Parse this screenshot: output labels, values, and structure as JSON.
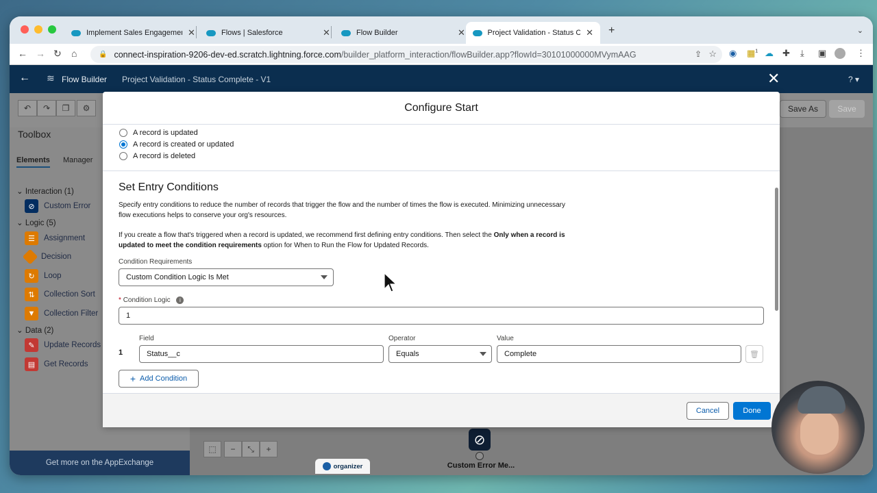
{
  "browser": {
    "tabs": [
      {
        "label": "Implement Sales Engagement"
      },
      {
        "label": "Flows | Salesforce"
      },
      {
        "label": "Flow Builder"
      },
      {
        "label": "Project Validation - Status Co"
      }
    ],
    "url_host": "connect-inspiration-9206-dev-ed.scratch.lightning.force.com",
    "url_path": "/builder_platform_interaction/flowBuilder.app?flowId=30101000000MVymAAG",
    "ext_badge": "1"
  },
  "app": {
    "title": "Flow Builder",
    "flow_name": "Project Validation - Status Complete - V1",
    "help": "?",
    "save_as": "Save As",
    "save": "Save"
  },
  "toolbox": {
    "title": "Toolbox",
    "tab_elements": "Elements",
    "tab_manager": "Manager",
    "sections": [
      {
        "label": "Interaction (1)",
        "items": [
          {
            "label": "Custom Error",
            "color": "#032d60"
          }
        ]
      },
      {
        "label": "Logic (5)",
        "items": [
          {
            "label": "Assignment",
            "color": "#dd7a01"
          },
          {
            "label": "Decision",
            "color": "#dd7a01"
          },
          {
            "label": "Loop",
            "color": "#dd7a01"
          },
          {
            "label": "Collection Sort",
            "color": "#dd7a01"
          },
          {
            "label": "Collection Filter",
            "color": "#dd7a01"
          }
        ]
      },
      {
        "label": "Data (2)",
        "items": [
          {
            "label": "Update Records",
            "color": "#c23934"
          },
          {
            "label": "Get Records",
            "color": "#c23934"
          }
        ]
      }
    ],
    "appexchange": "Get more on the AppExchange"
  },
  "canvas": {
    "node_label": "Custom Error Me...",
    "organizer_label": "organizer"
  },
  "modal": {
    "title": "Configure Start",
    "radios": [
      {
        "label": "A record is updated",
        "selected": false
      },
      {
        "label": "A record is created or updated",
        "selected": true
      },
      {
        "label": "A record is deleted",
        "selected": false
      }
    ],
    "section_title": "Set Entry Conditions",
    "para1_line1": "Specify entry conditions to reduce the number of records that trigger the flow and the number of times the flow is executed. Minimizing unnecessary",
    "para1_line2": "flow executions helps to conserve your org's resources.",
    "para2_a": "If you create a flow that's triggered when a record is updated, we recommend first defining entry conditions. Then select the ",
    "para2_bold1": "Only when a record is",
    "para2_bold2": "updated to meet the condition requirements",
    "para2_b": " option for When to Run the Flow for Updated Records.",
    "condition_requirements_label": "Condition Requirements",
    "condition_requirements_value": "Custom Condition Logic Is Met",
    "condition_logic_label": "Condition Logic",
    "condition_logic_value": "1",
    "field_header": "Field",
    "operator_header": "Operator",
    "value_header": "Value",
    "row_number": "1",
    "field_value": "Status__c",
    "operator_value": "Equals",
    "value_value": "Complete",
    "add_condition": "Add Condition",
    "cancel": "Cancel",
    "done": "Done"
  }
}
